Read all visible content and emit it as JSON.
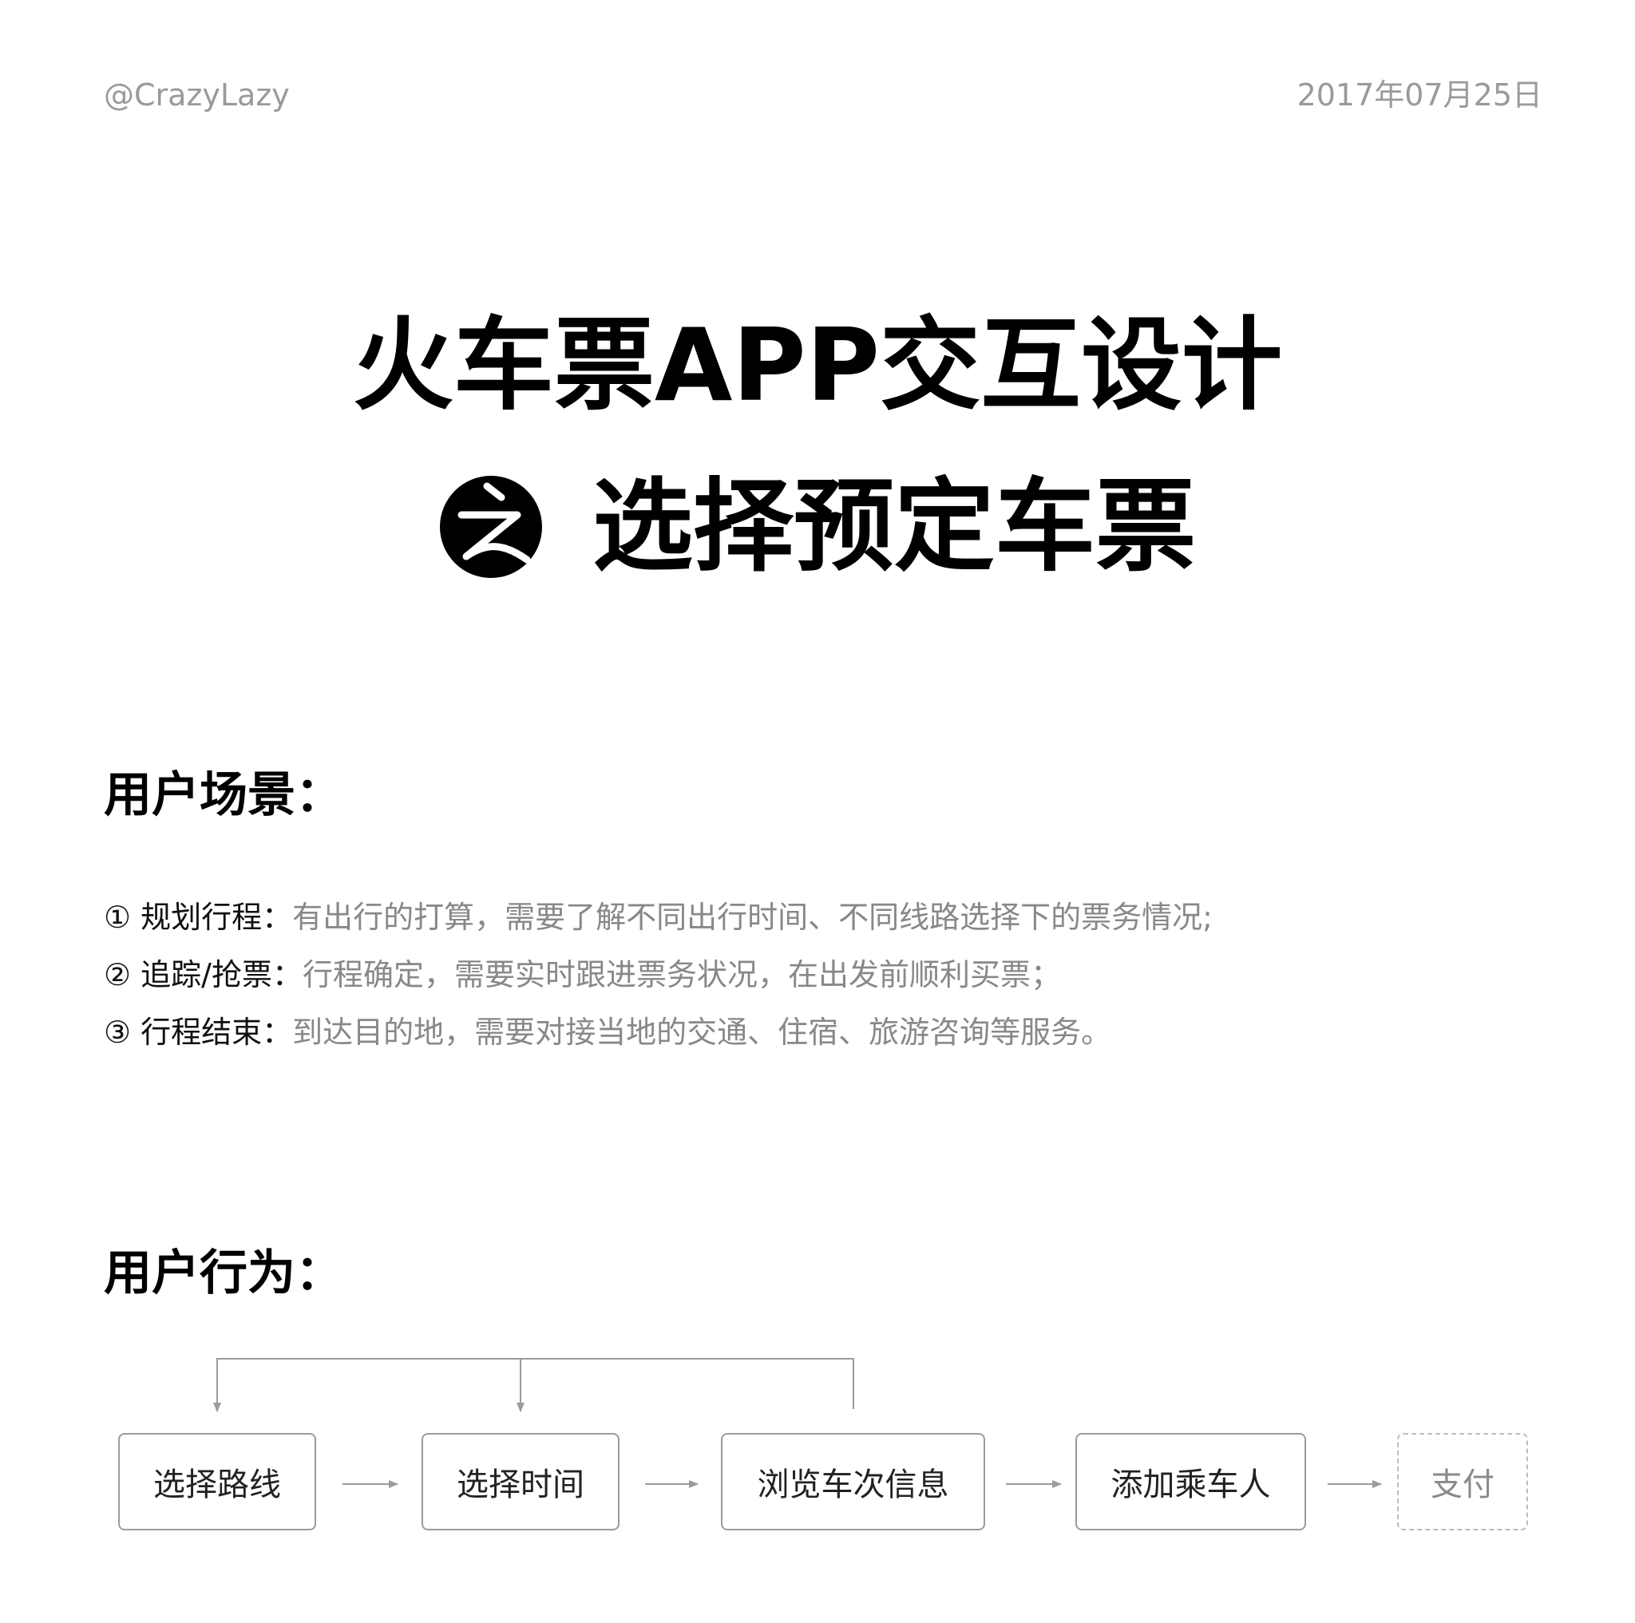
{
  "header": {
    "author": "@CrazyLazy",
    "date": "2017年07月25日"
  },
  "title": {
    "line1": "火车票APP交互设计",
    "badge_icon": "zhi-circle-icon",
    "line2": "选择预定车票"
  },
  "scenario": {
    "heading": "用户场景：",
    "items": [
      {
        "label": "① 规划行程：",
        "desc": "有出行的打算，需要了解不同出行时间、不同线路选择下的票务情况;"
      },
      {
        "label": "② 追踪/抢票：",
        "desc": "行程确定，需要实时跟进票务状况，在出发前顺利买票；"
      },
      {
        "label": "③ 行程结束：",
        "desc": "到达目的地，需要对接当地的交通、住宿、旅游咨询等服务。"
      }
    ]
  },
  "behavior": {
    "heading": "用户行为：",
    "steps": [
      "选择路线",
      "选择时间",
      "浏览车次信息",
      "添加乘车人",
      "支付"
    ],
    "colors": {
      "line": "#9b9b9b",
      "dashed": "#bdbdbd"
    }
  }
}
